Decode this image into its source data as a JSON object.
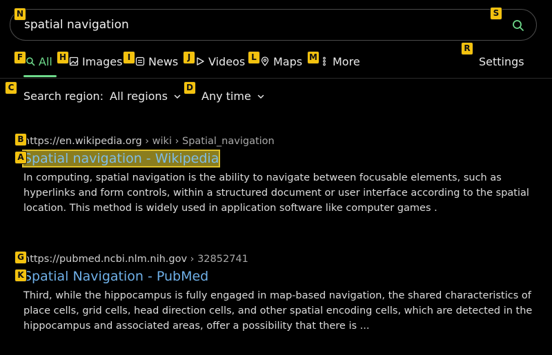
{
  "search": {
    "query": "spatial navigation"
  },
  "tabs": [
    {
      "label": "All",
      "icon": "search-icon",
      "active": true
    },
    {
      "label": "Images",
      "icon": "image-icon"
    },
    {
      "label": "News",
      "icon": "news-icon"
    },
    {
      "label": "Videos",
      "icon": "play-icon"
    },
    {
      "label": "Maps",
      "icon": "map-pin-icon"
    },
    {
      "label": "More",
      "icon": "more-vertical-icon"
    }
  ],
  "settings_label": "Settings",
  "filters": {
    "region_label": "Search region:",
    "region_value": "All regions",
    "time_value": "Any time"
  },
  "results": [
    {
      "url": "https://en.wikipedia.org",
      "crumb": " › wiki › Spatial_navigation",
      "title": "Spatial navigation - Wikipedia",
      "snippet": "In computing, spatial navigation is the ability to navigate between focusable elements, such as hyperlinks and form controls, within a structured document or user interface according to the spatial location. This method is widely used in application software like computer games ."
    },
    {
      "url": "https://pubmed.ncbi.nlm.nih.gov",
      "crumb": " › 32852741",
      "title": "Spatial Navigation - PubMed",
      "snippet": "Third, while the hippocampus is fully engaged in map-based navigation, the shared characteristics of place cells, grid cells, head direction cells, and other spatial encoding cells, which are detected in the hippocampus and associated areas, offer a possibility that there is ..."
    }
  ],
  "badges": {
    "a": "A",
    "b": "B",
    "c": "C",
    "d": "D",
    "f": "F",
    "g": "G",
    "h": "H",
    "i": "I",
    "j": "J",
    "k": "K",
    "l": "L",
    "m": "M",
    "n": "N",
    "r": "R",
    "s": "S"
  },
  "colors": {
    "accent": "#6ed98a",
    "link": "#6fb0e8",
    "badge": "#f3c20f",
    "background": "#000000"
  }
}
